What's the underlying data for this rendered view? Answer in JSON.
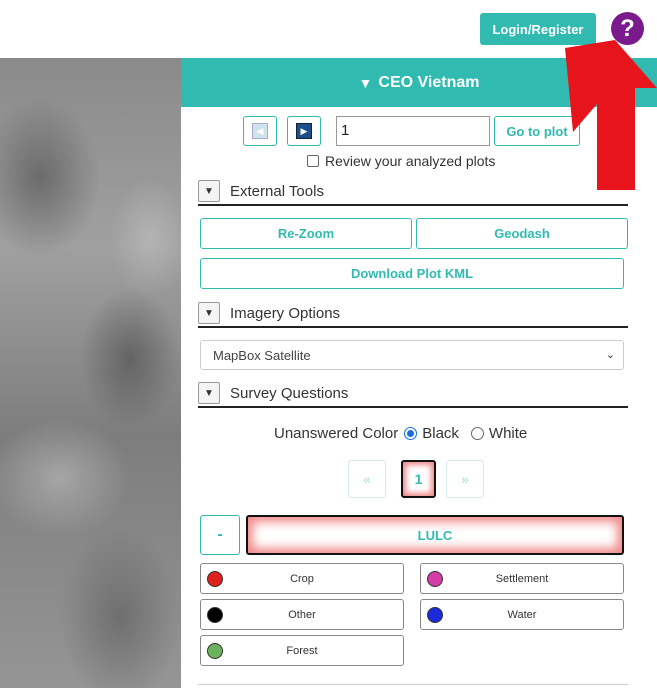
{
  "header": {
    "login_label": "Login/Register",
    "help_label": "?"
  },
  "panel": {
    "title": "CEO Vietnam",
    "nav": {
      "plot_value": "1",
      "goto_label": "Go to plot",
      "review_label": "Review your analyzed plots"
    },
    "external_tools": {
      "title": "External Tools",
      "rezoom_label": "Re-Zoom",
      "geodash_label": "Geodash",
      "kml_label": "Download Plot KML"
    },
    "imagery": {
      "title": "Imagery Options",
      "selected": "MapBox Satellite"
    },
    "survey": {
      "title": "Survey Questions",
      "unanswered_label": "Unanswered Color",
      "color_options": [
        "Black",
        "White"
      ],
      "selected_color": "Black",
      "pagination": {
        "prev": "«",
        "current": "1",
        "next": "»"
      },
      "collapse_label": "-",
      "question_label": "LULC",
      "answers": [
        {
          "label": "Crop",
          "color": "#e0201c"
        },
        {
          "label": "Settlement",
          "color": "#d43ca8"
        },
        {
          "label": "Other",
          "color": "#000000"
        },
        {
          "label": "Water",
          "color": "#1a2bd8"
        },
        {
          "label": "Forest",
          "color": "#6ab35c"
        }
      ]
    }
  },
  "colors": {
    "accent": "#31bab0",
    "help_button": "#7a1a8c",
    "arrow": "#e8141c"
  }
}
